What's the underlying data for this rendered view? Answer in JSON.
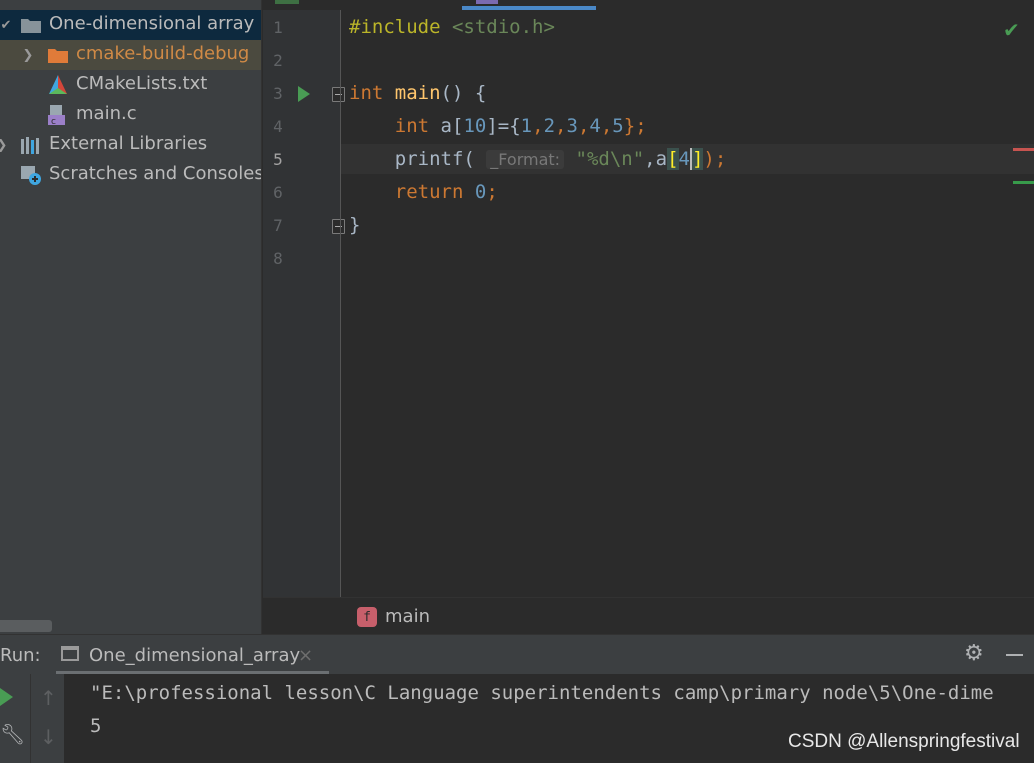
{
  "project_tree": {
    "items": [
      {
        "label": "One-dimensional array",
        "icon": "folder-icon",
        "expanded": true
      },
      {
        "label": "cmake-build-debug",
        "icon": "folder-icon",
        "expanded": false
      },
      {
        "label": "CMakeLists.txt",
        "icon": "cmake-icon"
      },
      {
        "label": "main.c",
        "icon": "c-file-icon"
      },
      {
        "label": "External Libraries",
        "icon": "libraries-icon",
        "expanded": false
      },
      {
        "label": "Scratches and Consoles",
        "icon": "scratches-icon"
      }
    ]
  },
  "editor": {
    "line_numbers": [
      "1",
      "2",
      "3",
      "4",
      "5",
      "6",
      "7",
      "8"
    ],
    "current_line": "5",
    "code": {
      "l1_directive": "#include",
      "l1_header": "<stdio.h>",
      "l3_type": "int",
      "l3_name": "main",
      "l3_rest": "() {",
      "l4_type": "int",
      "l4_var": "a",
      "l4_open": "[",
      "l4_size": "10",
      "l4_close": "]={",
      "l4_n1": "1",
      "l4_n2": "2",
      "l4_n3": "3",
      "l4_n4": "4",
      "l4_n5": "5",
      "l4_end": "};",
      "l5_fn": "printf(",
      "l5_hint": "_Format:",
      "l5_str": "\"%d\\n\"",
      "l5_mid": ",a",
      "l5_index": "4",
      "l5_end": ");",
      "l6_kw": "return",
      "l6_val": "0",
      "l6_end": ";",
      "l7": "}"
    },
    "breadcrumb": {
      "badge": "f",
      "label": "main"
    }
  },
  "run_panel": {
    "label": "Run:",
    "tab_label": "One_dimensional_array",
    "tab_close": "×",
    "console_lines": [
      "\"E:\\professional lesson\\C Language superintendents camp\\primary node\\5\\One-dime",
      "5"
    ]
  },
  "watermark": "CSDN @Allenspringfestival",
  "colors": {
    "keyword": "#cc7832",
    "function": "#ffc66d",
    "string": "#6a8759",
    "number": "#6897bb",
    "run_green": "#499c54",
    "selection": "#0d293e"
  }
}
